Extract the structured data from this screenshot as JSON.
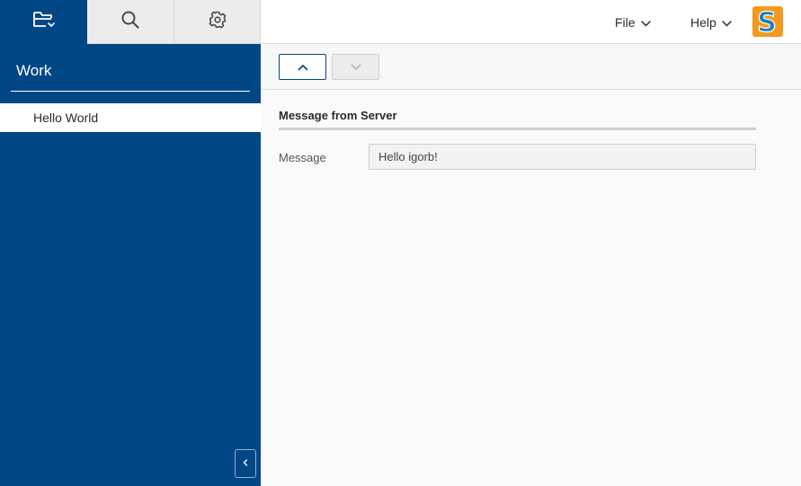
{
  "sidebar": {
    "tabs": [
      {
        "icon": "folder-icon",
        "active": true
      },
      {
        "icon": "search-icon",
        "active": false
      },
      {
        "icon": "gear-icon",
        "active": false
      }
    ],
    "title": "Work",
    "items": [
      {
        "label": "Hello World",
        "selected": true
      }
    ],
    "collapse_icon": "chevron-left-icon"
  },
  "header": {
    "menus": [
      {
        "label": "File"
      },
      {
        "label": "Help"
      }
    ],
    "logo_letter": "S"
  },
  "toolbar": {
    "up_icon": "chevron-up-icon",
    "down_icon": "chevron-down-icon",
    "down_enabled": false
  },
  "main": {
    "section_title": "Message from Server",
    "fields": [
      {
        "label": "Message",
        "value": "Hello igorb!"
      }
    ]
  },
  "colors": {
    "primary": "#014786",
    "logo_orange": "#f39a1e",
    "logo_blue": "#1a7fc1"
  }
}
